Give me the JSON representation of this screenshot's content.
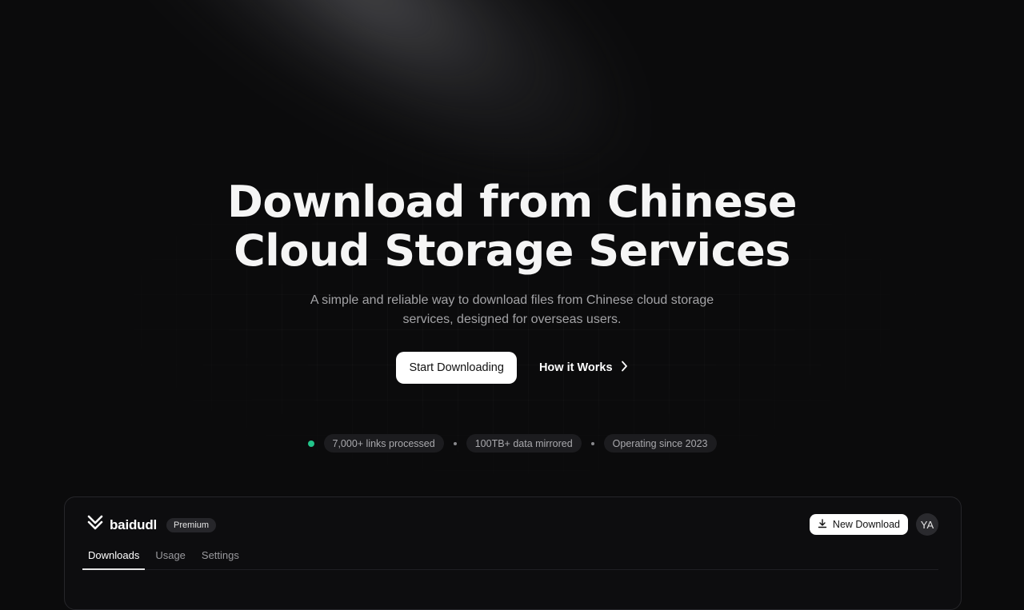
{
  "hero": {
    "title_line1": "Download from Chinese",
    "title_line2": "Cloud Storage Services",
    "subtitle": "A simple and reliable way to download files from Chinese cloud storage services, designed for overseas users."
  },
  "cta": {
    "primary_label": "Start Downloading",
    "secondary_label": "How it Works",
    "secondary_icon": "chevron-right-icon"
  },
  "stats": {
    "status_color": "#22c48a",
    "items": [
      "7,000+ links processed",
      "100TB+ data mirrored",
      "Operating since 2023"
    ]
  },
  "app_preview": {
    "brand": "baidudl",
    "logo_icon": "double-chevron-down-logo",
    "badge": "Premium",
    "new_download_label": "New Download",
    "new_download_icon": "download-icon",
    "avatar_initials": "YA",
    "tabs": [
      "Downloads",
      "Usage",
      "Settings"
    ],
    "active_tab": "Downloads"
  }
}
